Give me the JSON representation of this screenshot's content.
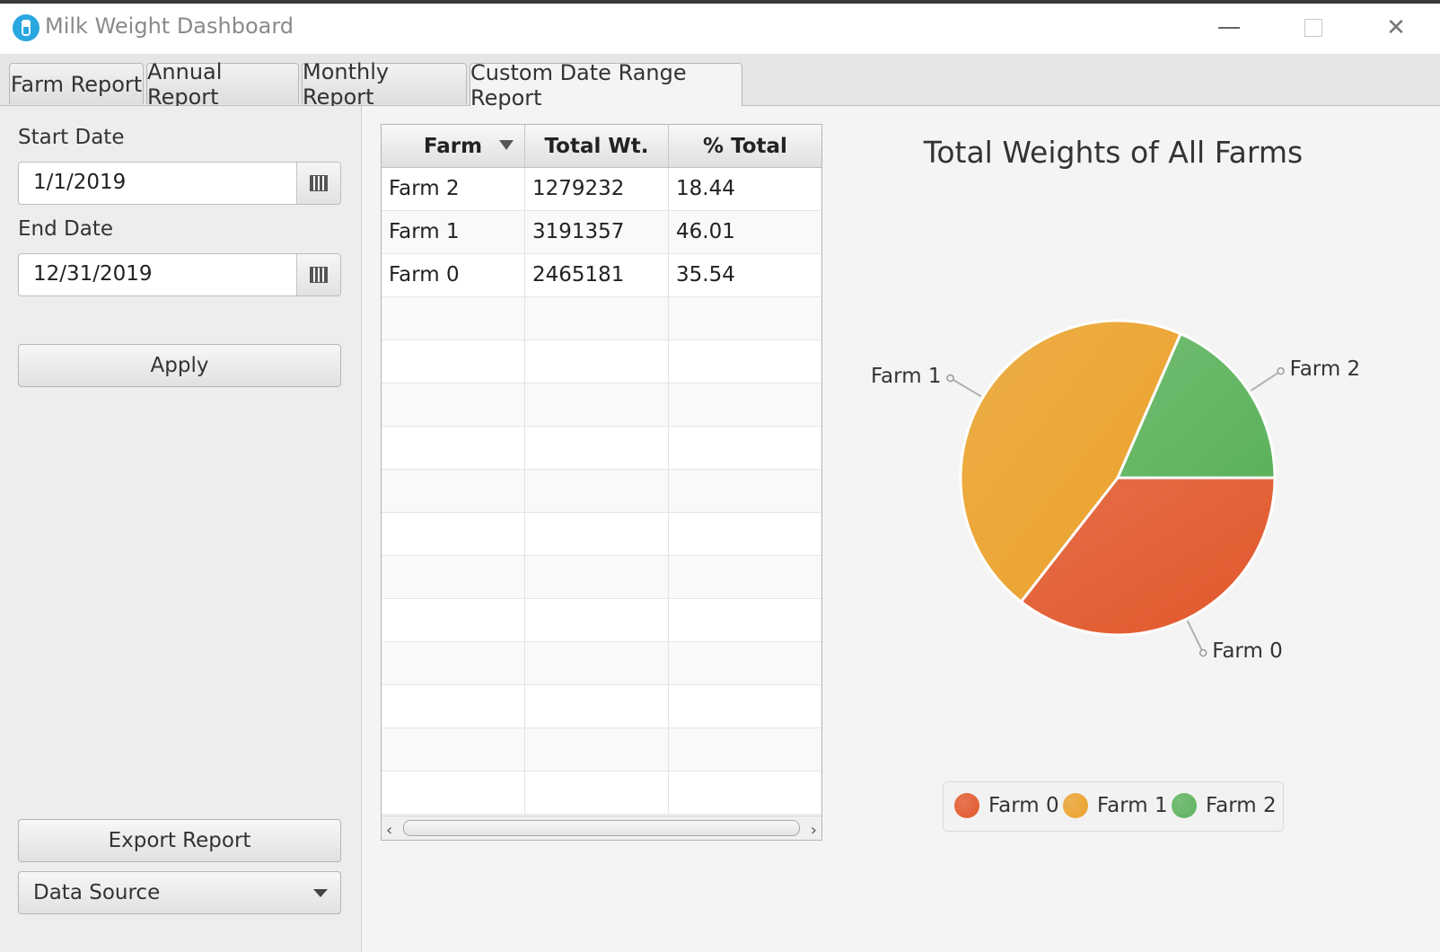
{
  "window": {
    "title": "Milk Weight Dashboard"
  },
  "tabs": [
    {
      "label": "Farm Report"
    },
    {
      "label": "Annual Report"
    },
    {
      "label": "Monthly Report"
    },
    {
      "label": "Custom Date Range Report"
    }
  ],
  "controls": {
    "start_label": "Start Date",
    "start_value": "1/1/2019",
    "end_label": "End Date",
    "end_value": "12/31/2019",
    "apply_label": "Apply",
    "export_label": "Export Report",
    "source_label": "Data Source"
  },
  "table": {
    "headers": [
      "Farm",
      "Total Wt.",
      "% Total"
    ],
    "rows": [
      [
        "Farm 2",
        "1279232",
        "18.44"
      ],
      [
        "Farm 1",
        "3191357",
        "46.01"
      ],
      [
        "Farm 0",
        "2465181",
        "35.54"
      ]
    ]
  },
  "colors": {
    "farm0": "#e2572a",
    "farm1": "#eba12a",
    "farm2": "#5bb25b"
  },
  "chart_data": {
    "type": "pie",
    "title": "Total Weights of All Farms",
    "categories": [
      "Farm 0",
      "Farm 1",
      "Farm 2"
    ],
    "values": [
      2465181,
      3191357,
      1279232
    ],
    "legend": [
      "Farm 0",
      "Farm 1",
      "Farm 2"
    ],
    "legend_position": "bottom"
  }
}
